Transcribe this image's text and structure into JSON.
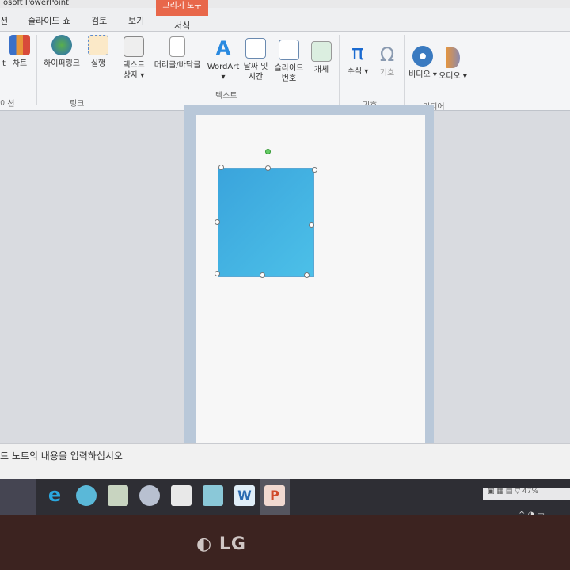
{
  "window": {
    "title": "osoft PowerPoint"
  },
  "tabs": [
    "션",
    "슬라이드 쇼",
    "검토",
    "보기"
  ],
  "context_tab": {
    "group": "그리기 도구",
    "tab": "서식",
    "color": "#e8674a"
  },
  "ribbon": {
    "buttons": [
      {
        "label": "t",
        "icon": "smartart-icon"
      },
      {
        "label": "차트",
        "icon": "chart-icon"
      },
      {
        "label": "하이퍼링크",
        "icon": "hyperlink-icon"
      },
      {
        "label": "실행",
        "icon": "action-icon"
      },
      {
        "label": "텍스트 상자 ▾",
        "icon": "textbox-icon"
      },
      {
        "label": "머리글/바닥글",
        "icon": "header-footer-icon"
      },
      {
        "label": "WordArt ▾",
        "icon": "wordart-icon"
      },
      {
        "label": "날짜 및 시간",
        "icon": "date-time-icon"
      },
      {
        "label": "슬라이드 번호",
        "icon": "slide-number-icon"
      },
      {
        "label": "개체",
        "icon": "object-icon"
      },
      {
        "label": "수식 ▾",
        "icon": "equation-icon"
      },
      {
        "label": "기호",
        "icon": "symbol-icon"
      },
      {
        "label": "비디오 ▾",
        "icon": "video-icon"
      },
      {
        "label": "오디오 ▾",
        "icon": "audio-icon"
      }
    ],
    "groups": [
      "이션",
      "링크",
      "텍스트",
      "기호",
      "미디어"
    ]
  },
  "notes": {
    "placeholder": "드 노트의 내용을 입력하십시오"
  },
  "status": {
    "zoom": "47%"
  },
  "taskbar": [
    "edge",
    "browser",
    "file-explorer",
    "snipping-tool",
    "sticky-notes",
    "calculator",
    "word",
    "powerpoint"
  ],
  "bezel": {
    "brand": "LG"
  }
}
